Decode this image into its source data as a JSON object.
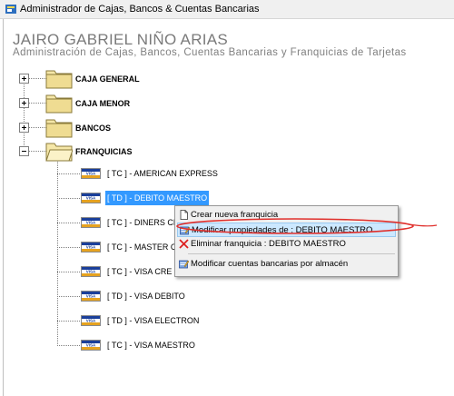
{
  "window": {
    "title": "Administrador de Cajas, Bancos & Cuentas Bancarias"
  },
  "header": {
    "user_name": "JAIRO GABRIEL NIÑO ARIAS",
    "subtitle": "Administración de Cajas, Bancos, Cuentas Bancarias y Franquicias de Tarjetas"
  },
  "tree": {
    "nodes": [
      {
        "label": "CAJA GENERAL",
        "expander": "plus"
      },
      {
        "label": "CAJA MENOR",
        "expander": "plus"
      },
      {
        "label": "BANCOS",
        "expander": "plus"
      },
      {
        "label": "FRANQUICIAS",
        "expander": "minus"
      }
    ],
    "franquicias": [
      {
        "label": "[ TC ] - AMERICAN EXPRESS"
      },
      {
        "label": "[ TD ] - DEBITO MAESTRO",
        "selected": true
      },
      {
        "label": "[ TC ] - DINERS CL"
      },
      {
        "label": "[ TC ] - MASTER C"
      },
      {
        "label": "[ TC ] - VISA CRE"
      },
      {
        "label": "[ TD ] - VISA DEBITO"
      },
      {
        "label": "[ TD ] - VISA ELECTRON"
      },
      {
        "label": "[ TC ] - VISA MAESTRO"
      }
    ],
    "card_text": "VISA"
  },
  "context_menu": {
    "items": [
      {
        "label": "Crear nueva franquicia",
        "icon": "new-document-icon"
      },
      {
        "label": "Modificar propiedades de : DEBITO MAESTRO",
        "icon": "edit-icon",
        "highlighted": true
      },
      {
        "label": "Eliminar franquicia : DEBITO MAESTRO",
        "icon": "delete-x-icon"
      },
      {
        "label": "Modificar cuentas bancarias por almacén",
        "icon": "edit-icon"
      }
    ]
  },
  "colors": {
    "selection": "#3399ff",
    "menu_highlight": "#cce8ff",
    "annotation": "#e0302c",
    "folder": "#f5e7a8"
  }
}
